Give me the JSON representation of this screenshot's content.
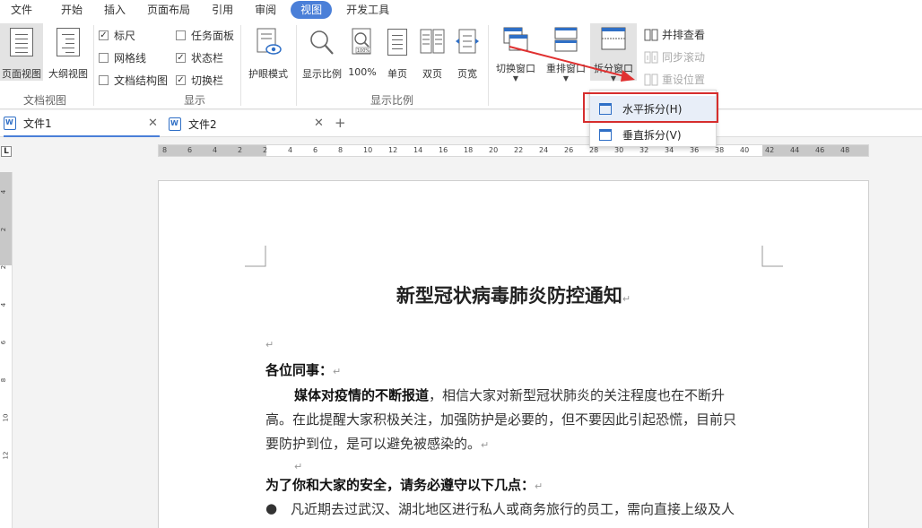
{
  "menu": [
    "文件",
    "开始",
    "插入",
    "页面布局",
    "引用",
    "审阅",
    "视图",
    "开发工具"
  ],
  "menu_active_index": 6,
  "ribbon": {
    "page_view": "页面视图",
    "outline": "大纲视图",
    "doc_view_group": "文档视图",
    "ruler": "标尺",
    "gridlines": "网格线",
    "doc_structure": "文档结构图",
    "task_pane": "任务面板",
    "status_bar": "状态栏",
    "tab_bar": "切换栏",
    "show_group": "显示",
    "eye_mode": "护眼模式",
    "zoom": "显示比例",
    "zoom100": "100%",
    "single": "单页",
    "double": "双页",
    "page_width": "页宽",
    "zoom_group": "显示比例",
    "switch_window": "切换窗口",
    "arrange_window": "重排窗口",
    "split_window": "拆分窗口",
    "side_by_side": "并排查看",
    "sync_scroll": "同步滚动",
    "reset_position": "重设位置"
  },
  "checks": {
    "ruler": true,
    "gridlines": false,
    "doc_structure": false,
    "task_pane": false,
    "status_bar": true,
    "tab_bar": true
  },
  "tabs": {
    "tab1": "文件1",
    "tab2": "文件2",
    "add": "+"
  },
  "split_menu": {
    "horizontal": "水平拆分(H)",
    "vertical": "垂直拆分(V)"
  },
  "ruler_ticks": [
    "8",
    "6",
    "4",
    "2",
    "2",
    "4",
    "6",
    "8",
    "10",
    "12",
    "14",
    "16",
    "18",
    "20",
    "22",
    "24",
    "26",
    "28",
    "30",
    "32",
    "34",
    "36",
    "38",
    "40",
    "42",
    "44",
    "46",
    "48"
  ],
  "vruler_ticks": [
    "4",
    "2",
    "2",
    "4",
    "6",
    "8",
    "10",
    "12"
  ],
  "document": {
    "title": "新型冠状病毒肺炎防控通知",
    "greeting": "各位同事：",
    "p1_bold": "媒体对疫情的不断报道",
    "p1_rest": "，相信大家对新型冠状肺炎的关注程度也在不断升",
    "p1_line2": "高。在此提醒大家积极关注，加强防护是必要的，但不要因此引起恐慌，目前只",
    "p1_line3": "要防护到位，是可以避免被感染的。",
    "heading2": "为了你和大家的安全，请务必遵守以下几点：",
    "bullet1": "凡近期去过武汉、湖北地区进行私人或商务旅行的员工，需向直接上级及人",
    "para_mark": "↵"
  },
  "colors": {
    "accent": "#4a7fd8",
    "highlight_box": "#d62d2d",
    "arrow": "#e03030"
  }
}
